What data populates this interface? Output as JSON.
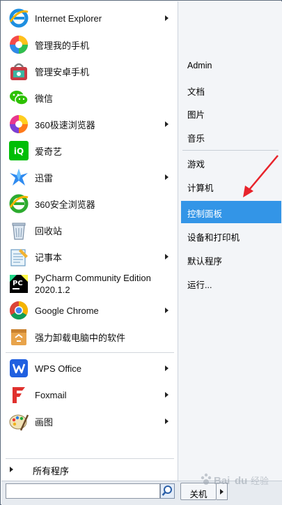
{
  "left_items": [
    {
      "id": "ie",
      "label": "Internet Explorer",
      "icon": "internet-explorer-icon",
      "arrow": true
    },
    {
      "id": "phone-manager",
      "label": "管理我的手机",
      "icon": "phone-manager-icon",
      "arrow": false
    },
    {
      "id": "android-manager",
      "label": "管理安卓手机",
      "icon": "android-manager-icon",
      "arrow": false
    },
    {
      "id": "wechat",
      "label": "微信",
      "icon": "wechat-icon",
      "arrow": false
    },
    {
      "id": "360-speed",
      "label": "360极速浏览器",
      "icon": "360-speed-browser-icon",
      "arrow": true
    },
    {
      "id": "iqiyi",
      "label": "爱奇艺",
      "icon": "iqiyi-icon",
      "arrow": false
    },
    {
      "id": "xunlei",
      "label": "迅雷",
      "icon": "xunlei-icon",
      "arrow": true
    },
    {
      "id": "360-safe",
      "label": "360安全浏览器",
      "icon": "360-safe-browser-icon",
      "arrow": false
    },
    {
      "id": "recycle",
      "label": "回收站",
      "icon": "recycle-bin-icon",
      "arrow": false
    },
    {
      "id": "notepad",
      "label": "记事本",
      "icon": "notepad-icon",
      "arrow": true
    },
    {
      "id": "pycharm",
      "label": "PyCharm Community Edition",
      "label2": "2020.1.2",
      "icon": "pycharm-icon",
      "arrow": false
    },
    {
      "id": "chrome",
      "label": "Google Chrome",
      "icon": "chrome-icon",
      "arrow": true
    },
    {
      "id": "uninstall",
      "label": "强力卸载电脑中的软件",
      "icon": "uninstaller-icon",
      "arrow": false
    },
    {
      "id": "wps",
      "label": "WPS Office",
      "icon": "wps-icon",
      "arrow": true
    },
    {
      "id": "foxmail",
      "label": "Foxmail",
      "icon": "foxmail-icon",
      "arrow": true
    },
    {
      "id": "paint",
      "label": "画图",
      "icon": "paint-icon",
      "arrow": true
    }
  ],
  "all_programs": "所有程序",
  "right_items": [
    {
      "id": "admin",
      "label": "Admin"
    },
    {
      "id": "documents",
      "label": "文档"
    },
    {
      "id": "pictures",
      "label": "图片"
    },
    {
      "id": "music",
      "label": "音乐"
    },
    {
      "id": "games",
      "label": "游戏"
    },
    {
      "id": "computer",
      "label": "计算机"
    },
    {
      "id": "control-panel",
      "label": "控制面板",
      "selected": true
    },
    {
      "id": "devices-printers",
      "label": "设备和打印机"
    },
    {
      "id": "default-programs",
      "label": "默认程序"
    },
    {
      "id": "run",
      "label": "运行..."
    }
  ],
  "search": {
    "placeholder": "",
    "value": ""
  },
  "shutdown_label": "关机",
  "watermark": "Baidu 经验",
  "colors": {
    "selected": "#3395e7",
    "annotation_arrow": "#e8232b"
  }
}
